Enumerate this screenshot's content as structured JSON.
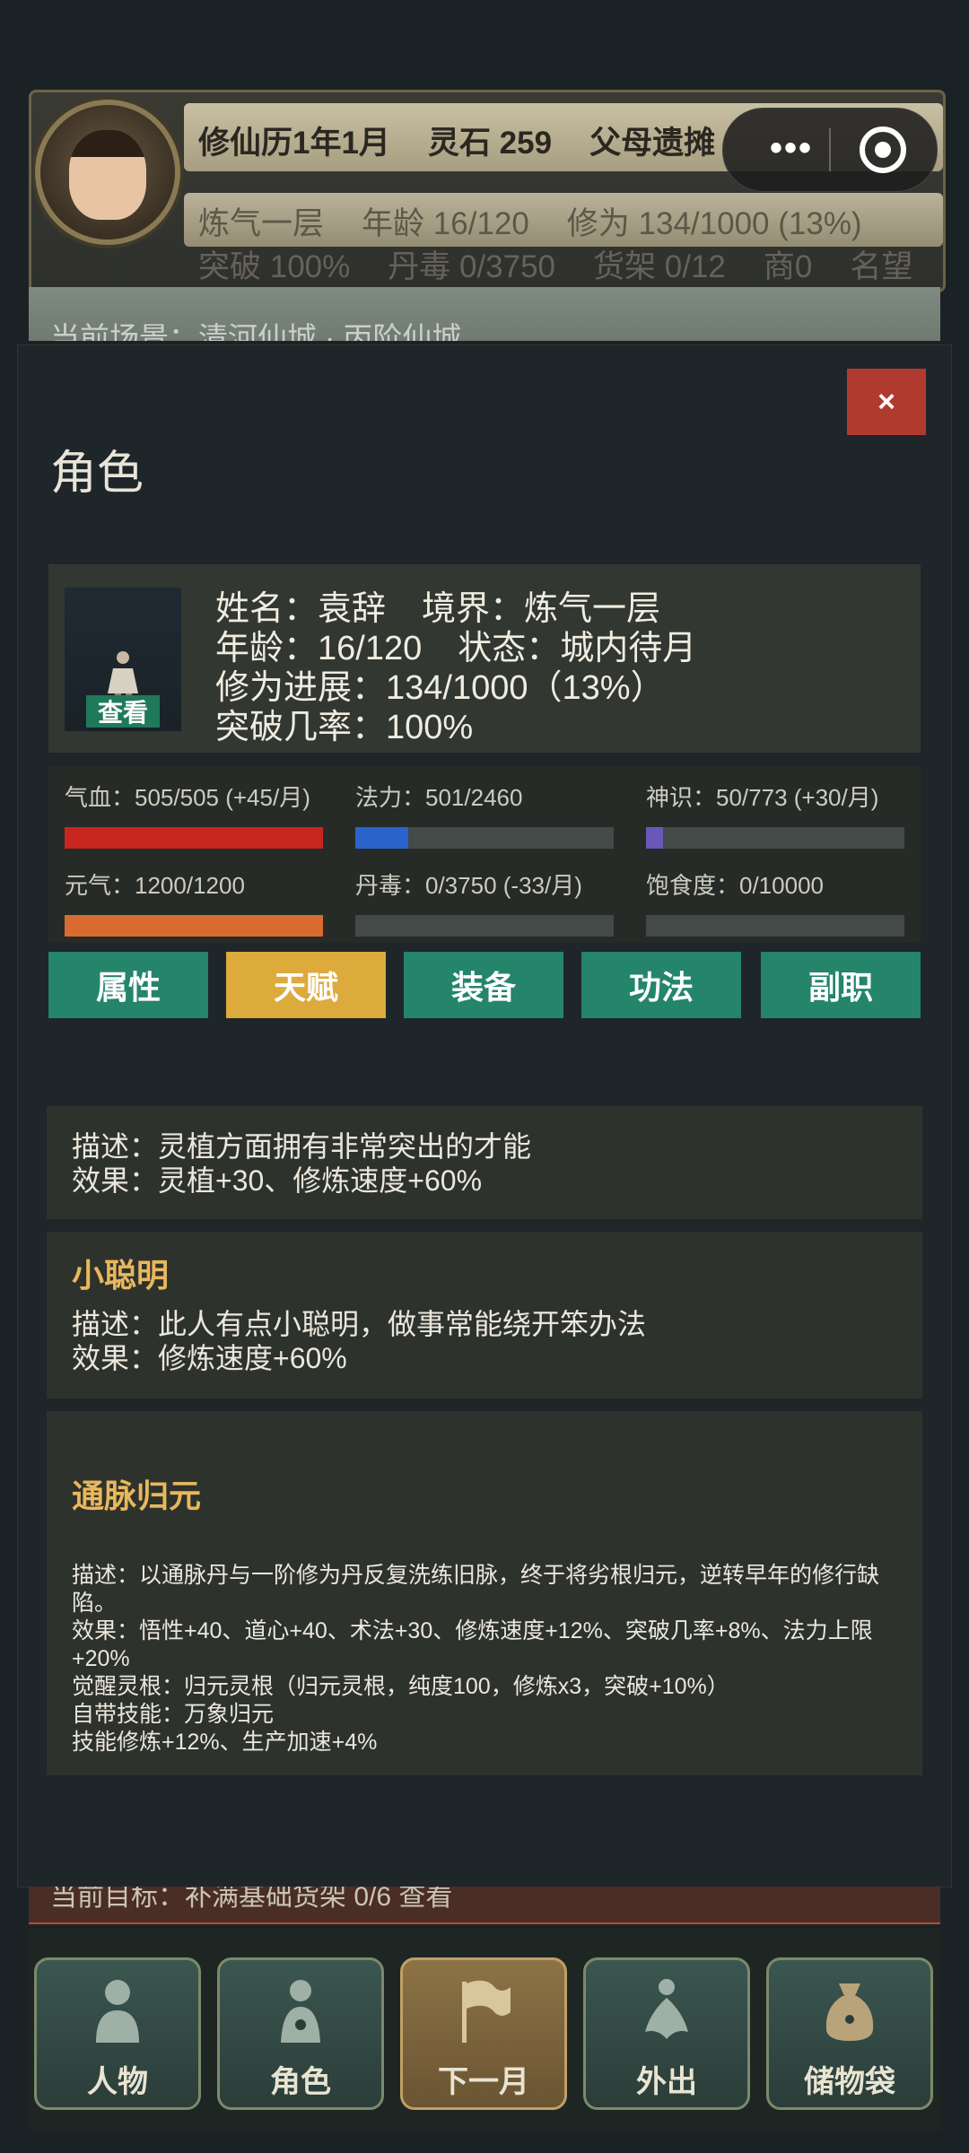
{
  "hud": {
    "row1": [
      "修仙历1年1月",
      "灵石 259",
      "父母遗摊"
    ],
    "row2": [
      "炼气一层",
      "年龄 16/120",
      "修为 134/1000 (13%)"
    ],
    "row3": [
      "突破 100%",
      "丹毒 0/3750",
      "货架 0/12",
      "商0",
      "名望"
    ],
    "scene": "当前场景：清河仙城 · 丙阶仙城"
  },
  "capsule": {
    "more_icon": "more-dots-icon",
    "close_icon": "target-icon"
  },
  "dialog": {
    "title": "角色",
    "close_label": "×",
    "profile": {
      "view_label": "查看",
      "name_label": "姓名：",
      "name": "袁辞",
      "realm_label": "境界：",
      "realm": "炼气一层",
      "age_label": "年龄：",
      "age": "16/120",
      "status_label": "状态：",
      "status": "城内待月",
      "progress_label": "修为进展：",
      "progress": "134/1000（13%）",
      "breakthrough_label": "突破几率：",
      "breakthrough": "100%"
    },
    "stats": [
      {
        "label": "气血：505/505 (+45/月)",
        "fraction": 1.0,
        "color": "#c6261e"
      },
      {
        "label": "法力：501/2460",
        "fraction": 0.2037,
        "color": "#2a63cc"
      },
      {
        "label": "神识：50/773 (+30/月)",
        "fraction": 0.0647,
        "color": "#6a58b8"
      },
      {
        "label": "元气：1200/1200",
        "fraction": 1.0,
        "color": "#d96a30"
      },
      {
        "label": "丹毒：0/3750 (-33/月)",
        "fraction": 0.0,
        "color": "#c6261e"
      },
      {
        "label": "饱食度：0/10000",
        "fraction": 0.0,
        "color": "#d9a030"
      }
    ],
    "tabs": [
      "属性",
      "天赋",
      "装备",
      "功法",
      "副职"
    ],
    "active_tab": 1,
    "talents": [
      {
        "desc": "描述：灵植方面拥有非常突出的才能",
        "effect": "效果：灵植+30、修炼速度+60%"
      },
      {
        "name": "小聪明",
        "desc": "描述：此人有点小聪明，做事常能绕开笨办法",
        "effect": "效果：修炼速度+60%"
      },
      {
        "name": "通脉归元",
        "desc": "描述：以通脉丹与一阶修为丹反复洗练旧脉，终于将劣根归元，逆转早年的修行缺陷。",
        "effect": "效果：悟性+40、道心+40、术法+30、修炼速度+12%、突破几率+8%、法力上限+20%",
        "root": "觉醒灵根：归元灵根（归元灵根，纯度100，修炼x3，突破+10%）",
        "skill": "自带技能：万象归元",
        "extra": "技能修炼+12%、生产加速+4%"
      }
    ]
  },
  "goal": "当前目标：补满基础货架 0/6  查看",
  "nav": [
    {
      "label": "人物",
      "icon": "person-icon"
    },
    {
      "label": "角色",
      "icon": "character-icon"
    },
    {
      "label": "下一月",
      "icon": "flag-icon"
    },
    {
      "label": "外出",
      "icon": "lotus-icon"
    },
    {
      "label": "储物袋",
      "icon": "bag-icon"
    }
  ]
}
